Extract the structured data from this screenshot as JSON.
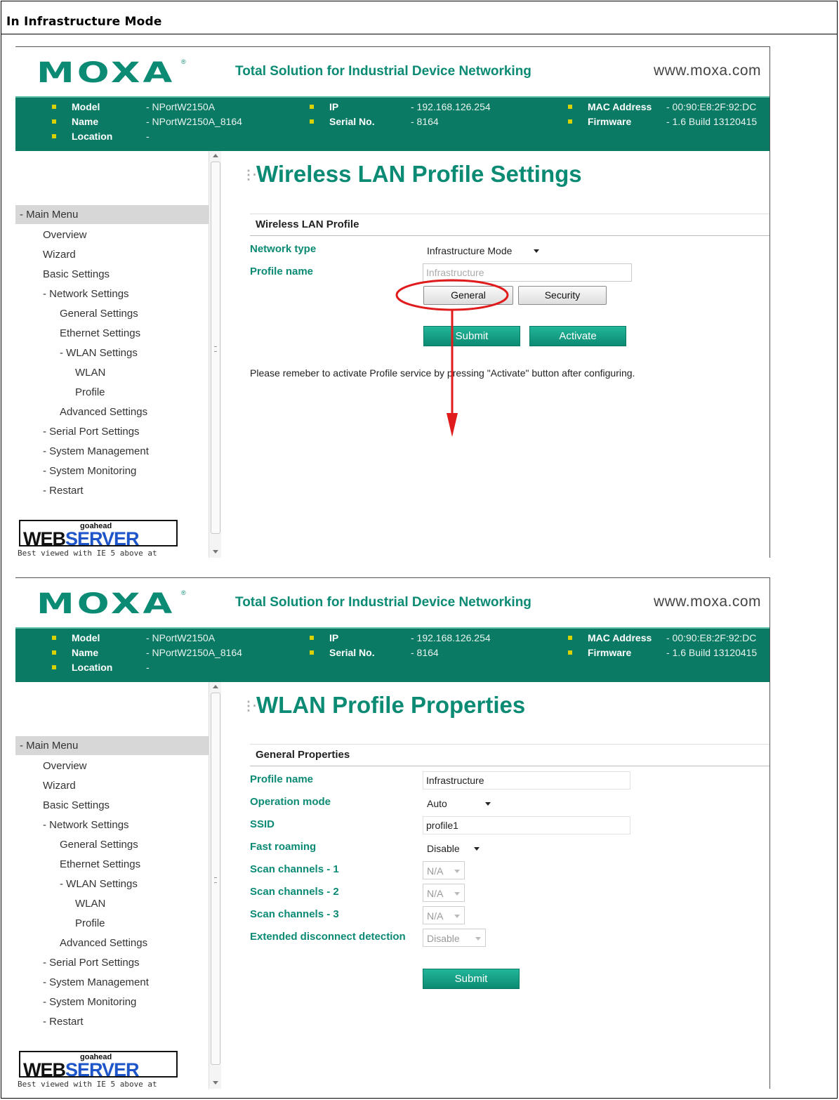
{
  "caption": "In Infrastructure Mode",
  "banner": {
    "logo": "MOXA",
    "logo_reg": "®",
    "tagline": "Total Solution for Industrial Device Networking",
    "url": "www.moxa.com"
  },
  "info": {
    "model_label": "Model",
    "model_value": "- NPortW2150A",
    "name_label": "Name",
    "name_value": "- NPortW2150A_8164",
    "location_label": "Location",
    "location_value": "-",
    "ip_label": "IP",
    "ip_value": "- 192.168.126.254",
    "serial_label": "Serial No.",
    "serial_value": "- 8164",
    "mac_label": "MAC Address",
    "mac_value": "- 00:90:E8:2F:92:DC",
    "firmware_label": "Firmware",
    "firmware_value": "- 1.6 Build 13120415"
  },
  "menu": {
    "head": "- Main Menu",
    "items": [
      "Overview",
      "Wizard",
      "Basic Settings",
      "- Network Settings",
      "General Settings",
      "Ethernet Settings",
      "- WLAN Settings",
      "WLAN",
      "Profile",
      "Advanced Settings",
      "- Serial Port Settings",
      "- System Management",
      "- System Monitoring",
      "- Restart"
    ]
  },
  "webserver": {
    "top": "goahead",
    "web": "WEB",
    "server": "SERVER",
    "best": "Best viewed with IE 5 above at"
  },
  "screen1": {
    "title": "Wireless LAN Profile Settings",
    "section": "Wireless LAN Profile",
    "network_type_label": "Network type",
    "network_type_value": "Infrastructure Mode",
    "profile_name_label": "Profile name",
    "profile_name_value": "Infrastructure",
    "general_button": "General",
    "security_button": "Security",
    "submit_button": "Submit",
    "activate_button": "Activate",
    "note": "Please remeber to activate Profile service by pressing \"Activate\" button after configuring."
  },
  "screen2": {
    "title": "WLAN Profile Properties",
    "section": "General Properties",
    "profile_name_label": "Profile name",
    "profile_name_value": "Infrastructure",
    "operation_mode_label": "Operation mode",
    "operation_mode_value": "Auto",
    "ssid_label": "SSID",
    "ssid_value": "profile1",
    "fast_roaming_label": "Fast roaming",
    "fast_roaming_value": "Disable",
    "scan1_label": "Scan channels - 1",
    "scan1_value": "N/A",
    "scan2_label": "Scan channels - 2",
    "scan2_value": "N/A",
    "scan3_label": "Scan channels - 3",
    "scan3_value": "N/A",
    "edd_label": "Extended disconnect detection",
    "edd_value": "Disable",
    "submit_button": "Submit"
  },
  "colors": {
    "brand": "#0b8a74",
    "infobar": "#0a7a64",
    "annotation": "#e01b1b"
  },
  "icons": [
    "title-dots-icon",
    "scroll-up-arrow-icon",
    "scroll-down-arrow-icon",
    "dropdown-caret-icon",
    "annotation-arrow"
  ]
}
